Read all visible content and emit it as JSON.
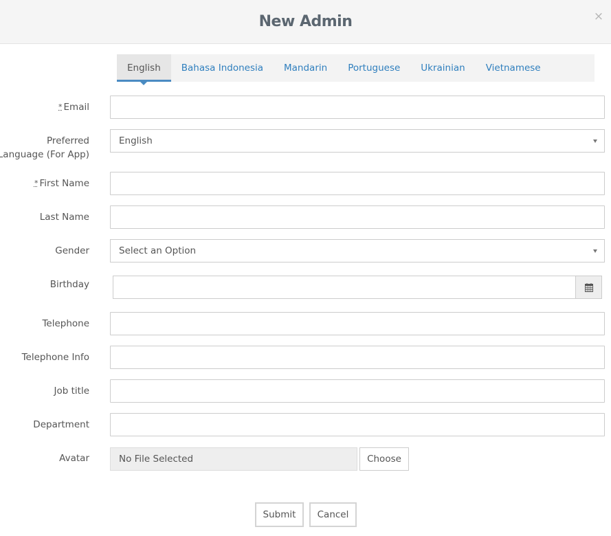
{
  "modal": {
    "title": "New Admin",
    "close_symbol": "×"
  },
  "tabs": [
    {
      "label": "English",
      "active": true
    },
    {
      "label": "Bahasa Indonesia",
      "active": false
    },
    {
      "label": "Mandarin",
      "active": false
    },
    {
      "label": "Portuguese",
      "active": false
    },
    {
      "label": "Ukrainian",
      "active": false
    },
    {
      "label": "Vietnamese",
      "active": false
    }
  ],
  "form": {
    "required_mark": "*",
    "email": {
      "label": "Email",
      "value": ""
    },
    "preferred_language": {
      "label_line1": "Preferred",
      "label_line2": "Language (For App)",
      "value": "English"
    },
    "first_name": {
      "label": "First Name",
      "value": ""
    },
    "last_name": {
      "label": "Last Name",
      "value": ""
    },
    "gender": {
      "label": "Gender",
      "value": "Select an Option"
    },
    "birthday": {
      "label": "Birthday",
      "value": "",
      "icon": "calendar-icon"
    },
    "telephone": {
      "label": "Telephone",
      "value": ""
    },
    "telephone_info": {
      "label": "Telephone Info",
      "value": ""
    },
    "job_title": {
      "label": "Job title",
      "value": ""
    },
    "department": {
      "label": "Department",
      "value": ""
    },
    "avatar": {
      "label": "Avatar",
      "file_status": "No File Selected",
      "choose_label": "Choose"
    }
  },
  "actions": {
    "submit_label": "Submit",
    "cancel_label": "Cancel"
  },
  "colors": {
    "header_bg": "#f5f5f5",
    "title": "#5b6670",
    "tab_link": "#2f7fbe",
    "tab_active_border": "#4a8bc2",
    "tabbar_bg": "#f3f3f3"
  }
}
